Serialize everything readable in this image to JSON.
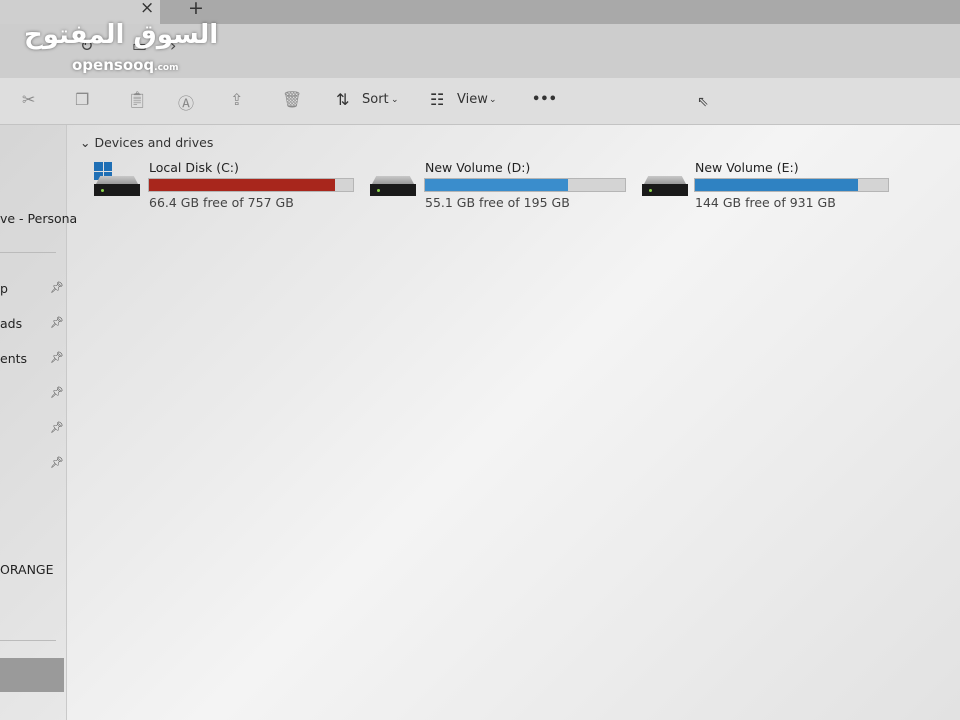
{
  "watermark": {
    "arabic": "السوق المفتوح",
    "latin": "opensooq.com"
  },
  "tabs": {
    "close_icon": "×",
    "new_tab_icon": "+"
  },
  "toolbar": {
    "icons": [
      "cut-icon",
      "copy-icon",
      "paste-icon",
      "rename-icon",
      "share-icon",
      "delete-icon"
    ],
    "sort_label": "Sort",
    "view_label": "View",
    "more_label": "•••"
  },
  "sidebar": {
    "items": [
      {
        "label": "ve - Persona",
        "pinned": false
      },
      {
        "label": "p",
        "pinned": true
      },
      {
        "label": "ads",
        "pinned": true
      },
      {
        "label": "ents",
        "pinned": true
      },
      {
        "label": "",
        "pinned": true
      },
      {
        "label": "",
        "pinned": true
      },
      {
        "label": "",
        "pinned": true
      },
      {
        "label": "ORANGE",
        "pinned": false
      }
    ]
  },
  "main": {
    "section_title": "Devices and drives",
    "drives": [
      {
        "name": "Local Disk (C:)",
        "free_text": "66.4 GB free of 757 GB",
        "used_fraction": 0.912,
        "bar_color": "#a8261c",
        "system": true
      },
      {
        "name": "New Volume (D:)",
        "free_text": "55.1 GB free of 195 GB",
        "used_fraction": 0.717,
        "bar_color": "#3a8dcc",
        "system": false
      },
      {
        "name": "New Volume (E:)",
        "free_text": "144 GB free of 931 GB",
        "used_fraction": 0.845,
        "bar_color": "#2f82c2",
        "system": false
      }
    ]
  }
}
